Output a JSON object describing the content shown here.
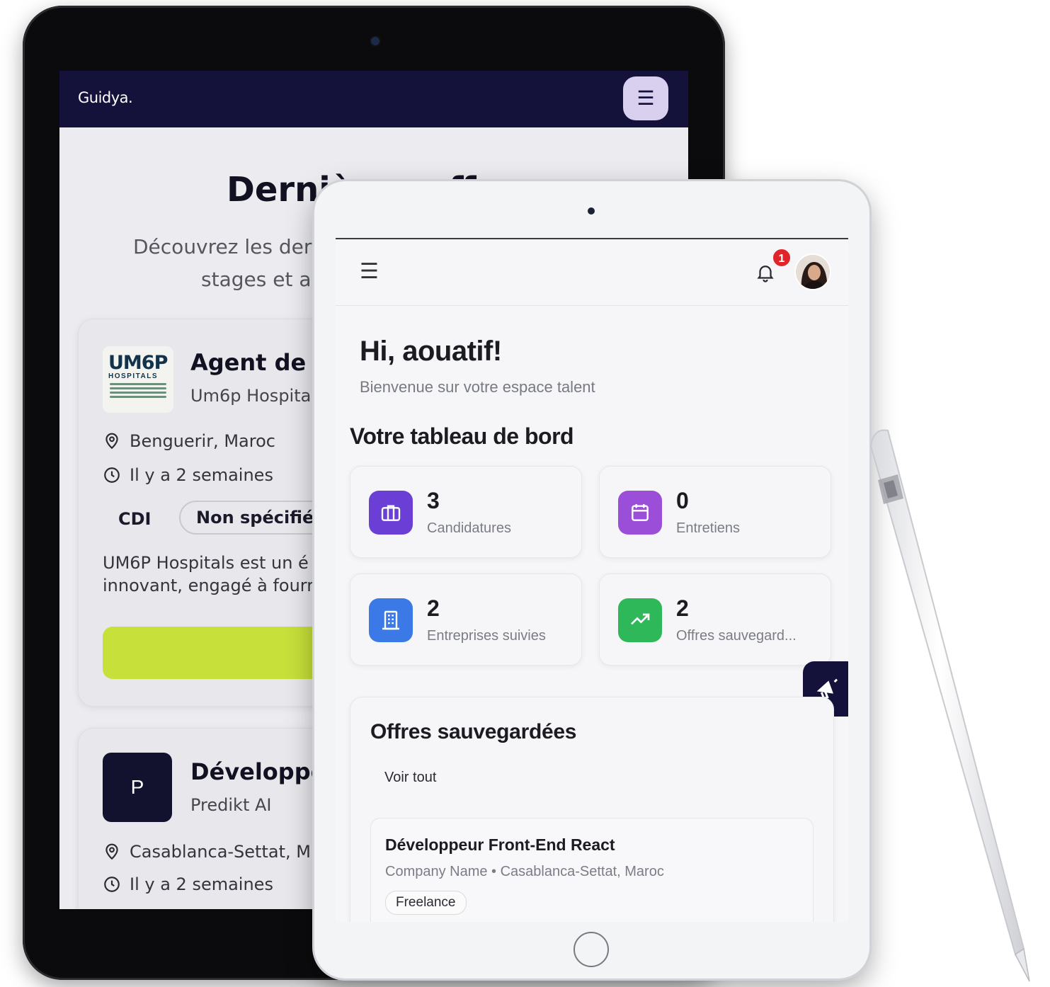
{
  "back_app": {
    "brand": "Guidya.",
    "menu_icon_glyph": "☰",
    "section_title": "Dernières offres",
    "section_subtitle_line1": "Découvrez les der",
    "section_subtitle_line2": "stages et al",
    "jobs": [
      {
        "logo_text_main": "UM6P",
        "logo_text_sub": "HOSPITALS",
        "title": "Agent de F",
        "company": "Um6p Hospita",
        "location": "Benguerir, Maroc",
        "posted": "Il y a 2 semaines",
        "contract": "CDI",
        "tag": "Non spécifié",
        "description_line1": "UM6P Hospitals est un é",
        "description_line2": "innovant, engagé à fourr",
        "apply_color": "#c8e03a"
      },
      {
        "logo_letter": "P",
        "title": "Développe",
        "company": "Predikt AI",
        "location": "Casablanca-Settat, M",
        "posted": "Il y a 2 semaines"
      }
    ]
  },
  "front_app": {
    "menu_icon_glyph": "☰",
    "notification_count": "1",
    "greeting": "Hi, aouatif!",
    "welcome": "Bienvenue sur votre espace talent",
    "dashboard_title": "Votre tableau de bord",
    "stats": [
      {
        "value": "3",
        "label": "Candidatures",
        "icon": "briefcase-icon",
        "color": "#6b3fd6"
      },
      {
        "value": "0",
        "label": "Entretiens",
        "icon": "calendar-icon",
        "color": "#9b4fd8"
      },
      {
        "value": "2",
        "label": "Entreprises suivies",
        "icon": "building-icon",
        "color": "#3b7ae6"
      },
      {
        "value": "2",
        "label": "Offres sauvegard...",
        "icon": "trending-up-icon",
        "color": "#2fb85a"
      }
    ],
    "saved_offers": {
      "title": "Offres sauvegardées",
      "see_all": "Voir tout",
      "items": [
        {
          "title": "Développeur Front-End React",
          "meta": "Company Name • Casablanca-Settat, Maroc",
          "tag": "Freelance"
        }
      ]
    },
    "colors": {
      "dark_navy": "#14123a",
      "badge_red": "#e0242b"
    }
  }
}
